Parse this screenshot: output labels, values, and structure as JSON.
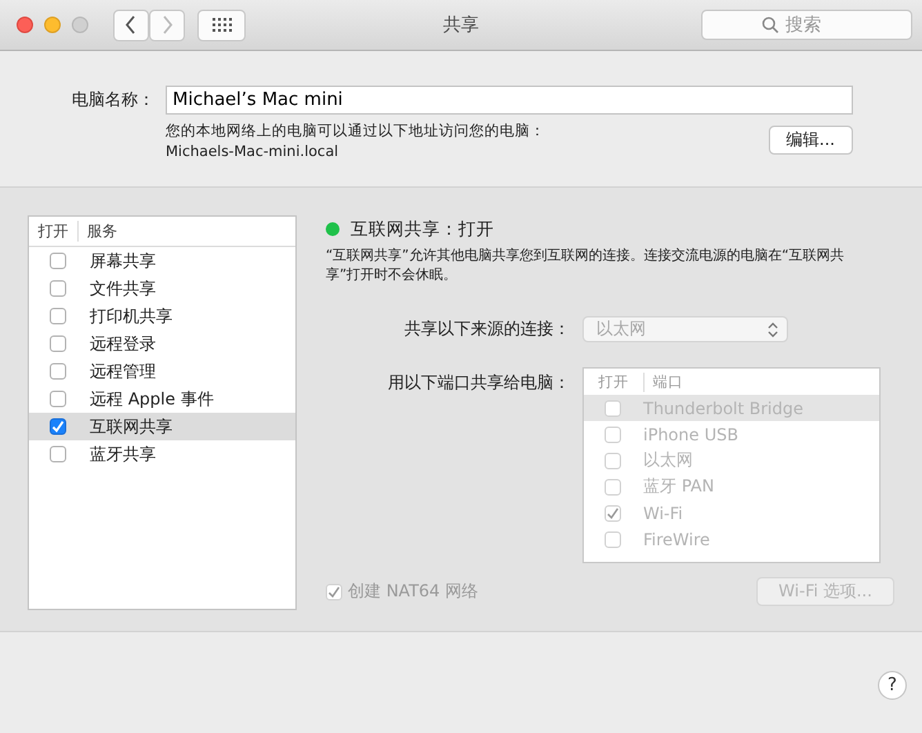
{
  "window": {
    "title": "共享",
    "search": {
      "placeholder": "搜索"
    }
  },
  "computer_name": {
    "label": "电脑名称：",
    "value": "Michael’s Mac mini",
    "hint": "您的本地网络上的电脑可以通过以下地址访问您的电脑：",
    "address": "Michaels-Mac-mini.local",
    "edit_button": "编辑..."
  },
  "services": {
    "columns": [
      "打开",
      "服务"
    ],
    "rows": [
      {
        "name": "屏幕共享",
        "checked": false,
        "selected": false
      },
      {
        "name": "文件共享",
        "checked": false,
        "selected": false
      },
      {
        "name": "打印机共享",
        "checked": false,
        "selected": false
      },
      {
        "name": "远程登录",
        "checked": false,
        "selected": false
      },
      {
        "name": "远程管理",
        "checked": false,
        "selected": false
      },
      {
        "name": "远程 Apple 事件",
        "checked": false,
        "selected": false
      },
      {
        "name": "互联网共享",
        "checked": true,
        "selected": true
      },
      {
        "name": "蓝牙共享",
        "checked": false,
        "selected": false
      }
    ]
  },
  "status": {
    "on": true,
    "text": "互联网共享：打开"
  },
  "description": "“互联网共享”允许其他电脑共享您到互联网的连接。连接交流电源的电脑在“互联网共享”打开时不会休眠。",
  "source": {
    "label": "共享以下来源的连接：",
    "value": "以太网",
    "disabled": true
  },
  "ports": {
    "label": "用以下端口共享给电脑：",
    "disabled": true,
    "columns": [
      "打开",
      "端口"
    ],
    "rows": [
      {
        "name": "Thunderbolt Bridge",
        "checked": false,
        "selected": true
      },
      {
        "name": "iPhone USB",
        "checked": false,
        "selected": false
      },
      {
        "name": "以太网",
        "checked": false,
        "selected": false
      },
      {
        "name": "蓝牙 PAN",
        "checked": false,
        "selected": false
      },
      {
        "name": "Wi-Fi",
        "checked": true,
        "selected": false
      },
      {
        "name": "FireWire",
        "checked": false,
        "selected": false
      }
    ]
  },
  "nat64": {
    "label": "创建 NAT64 网络",
    "checked": true,
    "disabled": true
  },
  "wifi_options_button": {
    "label": "Wi-Fi 选项...",
    "disabled": true
  },
  "help_button": "?"
}
